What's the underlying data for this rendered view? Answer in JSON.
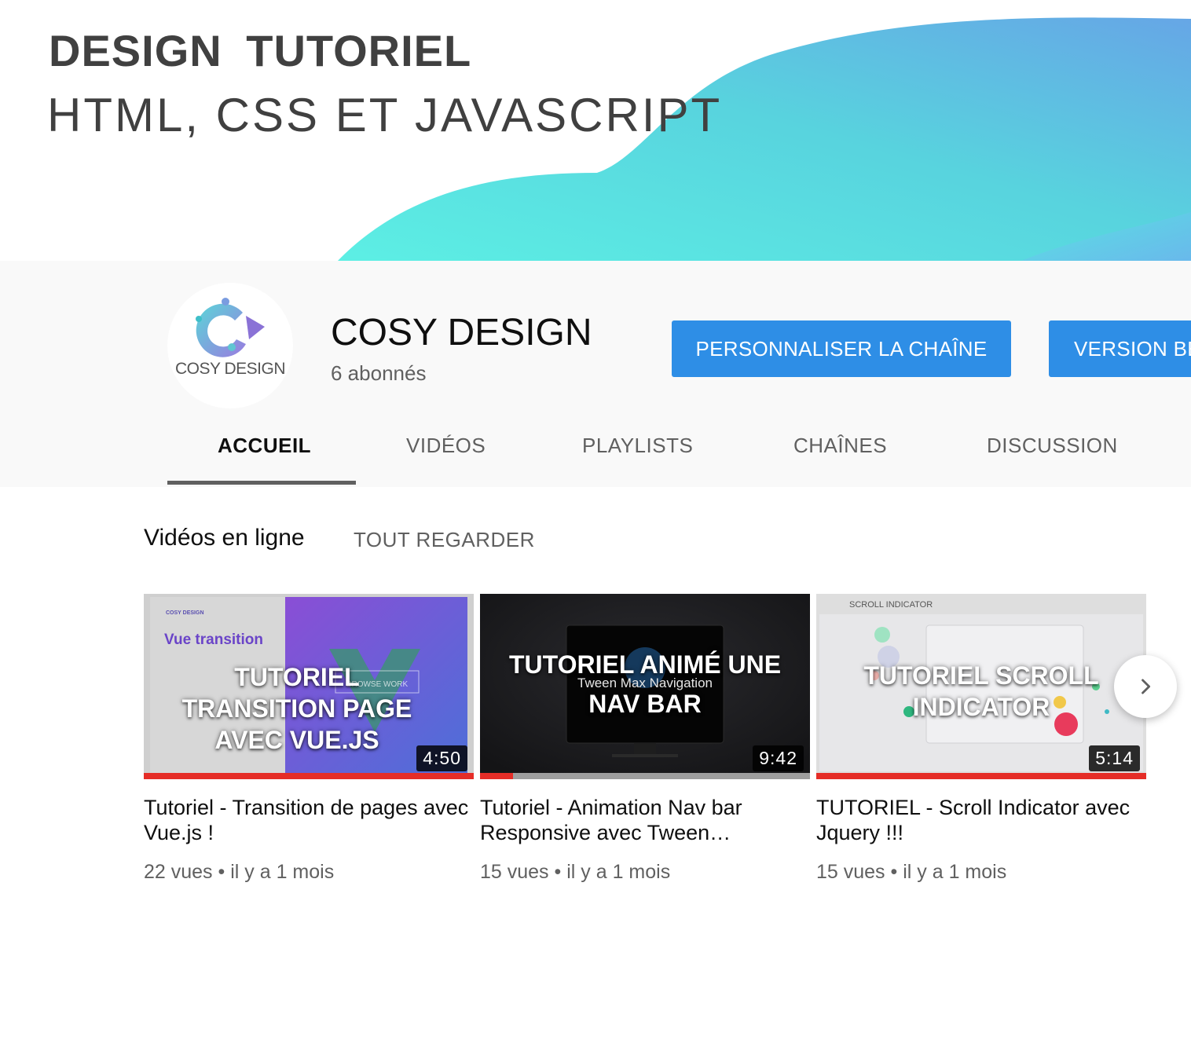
{
  "banner": {
    "title": "DESIGN TUTORIEL",
    "subtitle": "HTML, CSS ET JAVASCRIPT"
  },
  "channel": {
    "avatar_text": "COSY DESIGN",
    "name": "COSY DESIGN",
    "subscribers": "6 abonnés",
    "customize_button": "PERSONNALISER LA CHAÎNE",
    "beta_button": "VERSION BÊTA"
  },
  "tabs": [
    {
      "label": "ACCUEIL",
      "active": true
    },
    {
      "label": "VIDÉOS",
      "active": false
    },
    {
      "label": "PLAYLISTS",
      "active": false
    },
    {
      "label": "CHAÎNES",
      "active": false
    },
    {
      "label": "DISCUSSION",
      "active": false
    }
  ],
  "section": {
    "title": "Vidéos en ligne",
    "see_all": "TOUT REGARDER"
  },
  "videos": [
    {
      "thumb_text": "TUTORIEL TRANSITION PAGE AVEC VUE.JS",
      "thumb_small_text": "Vue transition",
      "thumb_logo": "COSY DESIGN",
      "thumb_button": "BROWSE WORK",
      "duration": "4:50",
      "progress": 1.0,
      "title": "Tutoriel - Transition de pages avec Vue.js !",
      "views": "22 vues",
      "age": "il y a 1 mois"
    },
    {
      "thumb_text_line1": "TUTORIEL ANIMÉ UNE",
      "thumb_text_line2": "NAV BAR",
      "thumb_small_text": "Tween Max Navigation",
      "duration": "9:42",
      "progress": 0.1,
      "title": "Tutoriel - Animation Nav bar Responsive avec Tween…",
      "views": "15 vues",
      "age": "il y a 1 mois"
    },
    {
      "thumb_text_line1": "TUTORIEL SCROLL",
      "thumb_text_line2": "INDICATOR",
      "thumb_small_text": "SCROLL INDICATOR",
      "duration": "5:14",
      "progress": 1.0,
      "title": "TUTORIEL - Scroll Indicator avec Jquery !!!",
      "views": "15 vues",
      "age": "il y a 1 mois"
    }
  ],
  "meta_separator": "•",
  "colors": {
    "accent_blue": "#2e8ee6",
    "progress_red": "#e52d27",
    "banner_wave_start": "#5ee9e3",
    "banner_wave_end": "#6fa8f2"
  },
  "icons": {
    "next": "chevron-right-icon"
  }
}
